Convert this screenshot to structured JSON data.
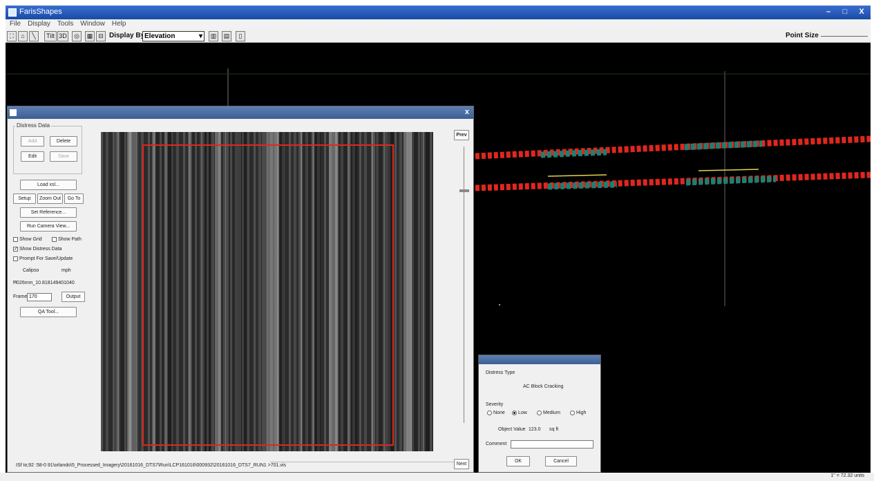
{
  "window": {
    "title": "FarisShapes"
  },
  "menu": {
    "items": [
      "File",
      "Display",
      "Tools",
      "Window",
      "Help"
    ]
  },
  "toolbar": {
    "tilt_label": "Tilt",
    "three_d_label": "3D",
    "display_by_label": "Display By",
    "display_by_value": "Elevation",
    "point_size_label": "Point Size"
  },
  "dialog": {
    "group_title": "Distress Data",
    "buttons": {
      "add": "Add",
      "delete": "Delete",
      "edit": "Edit",
      "save": "Save",
      "load_xsl": "Load xsl...",
      "setup": "Setup",
      "zoom_out": "Zoom Out",
      "go_to": "Go To",
      "set_reference": "Set Reference...",
      "run_camera_view": "Run Camera View...",
      "output": "Output",
      "qa_tool": "QA Tool..."
    },
    "checkboxes": {
      "show_grid": "Show Grid",
      "show_path": "Show Path",
      "show_distress_data": "Show Distress Data",
      "prompt_for_save": "Prompt For Save/Update"
    },
    "calipso_label": "Calipso",
    "speed_unit": "mph",
    "frame_info": "Ħ026mm_10.818149401040",
    "frame_label": "Frame",
    "frame_value": "170",
    "prev_label": "Prev",
    "next_label": "Next",
    "image_path": "ISf  to;92 :58-0 91\\orlando\\5_Processed_Imagery\\20161016_DTS7\\Run\\LCP161016\\000932\\20161016_DTS7_RUN1 >701.vis"
  },
  "distress_dialog": {
    "title": "Distress Type",
    "type_value": "AC Block Cracking",
    "severity_label": "Severity",
    "severity_options": [
      "None",
      "Low",
      "Medium",
      "High"
    ],
    "object_value_label": "Object Value",
    "object_value": "123.0",
    "object_value_unit": "sq ft",
    "comment_label": "Comment",
    "ok_label": "OK",
    "cancel_label": "Cancel"
  },
  "statusbar": {
    "coord": "1\" = 72.32 units"
  },
  "colors": {
    "crack_red": "#e0271d",
    "crack_teal": "#1e7f73",
    "marker_yellow": "#e8d34a"
  }
}
